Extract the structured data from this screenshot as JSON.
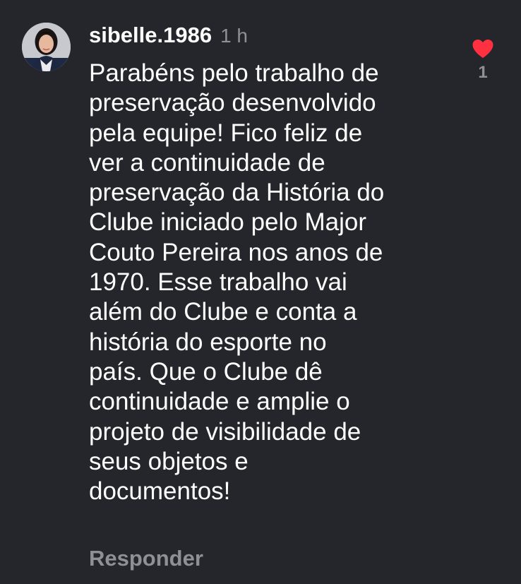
{
  "comment": {
    "username": "sibelle.1986",
    "time": "1 h",
    "text": "Parabéns pelo trabalho de\npreservação desenvolvido\npela equipe! Fico feliz de\nver a continuidade de\npreservação da História do\nClube iniciado pelo Major\nCouto Pereira nos anos de\n1970. Esse trabalho vai\nalém do Clube e conta a\nhistória do esporte no\npaís. Que o Clube dê\ncontinuidade e amplie o\nprojeto de visibilidade de\nseus objetos e\ndocumentos!",
    "reply_label": "Responder",
    "like_count": "1",
    "liked": true
  },
  "icons": {
    "like": "heart-icon",
    "avatar": "avatar"
  },
  "colors": {
    "background": "#25262b",
    "text": "#ffffff",
    "muted": "#8e9096",
    "heart": "#ff3040"
  }
}
